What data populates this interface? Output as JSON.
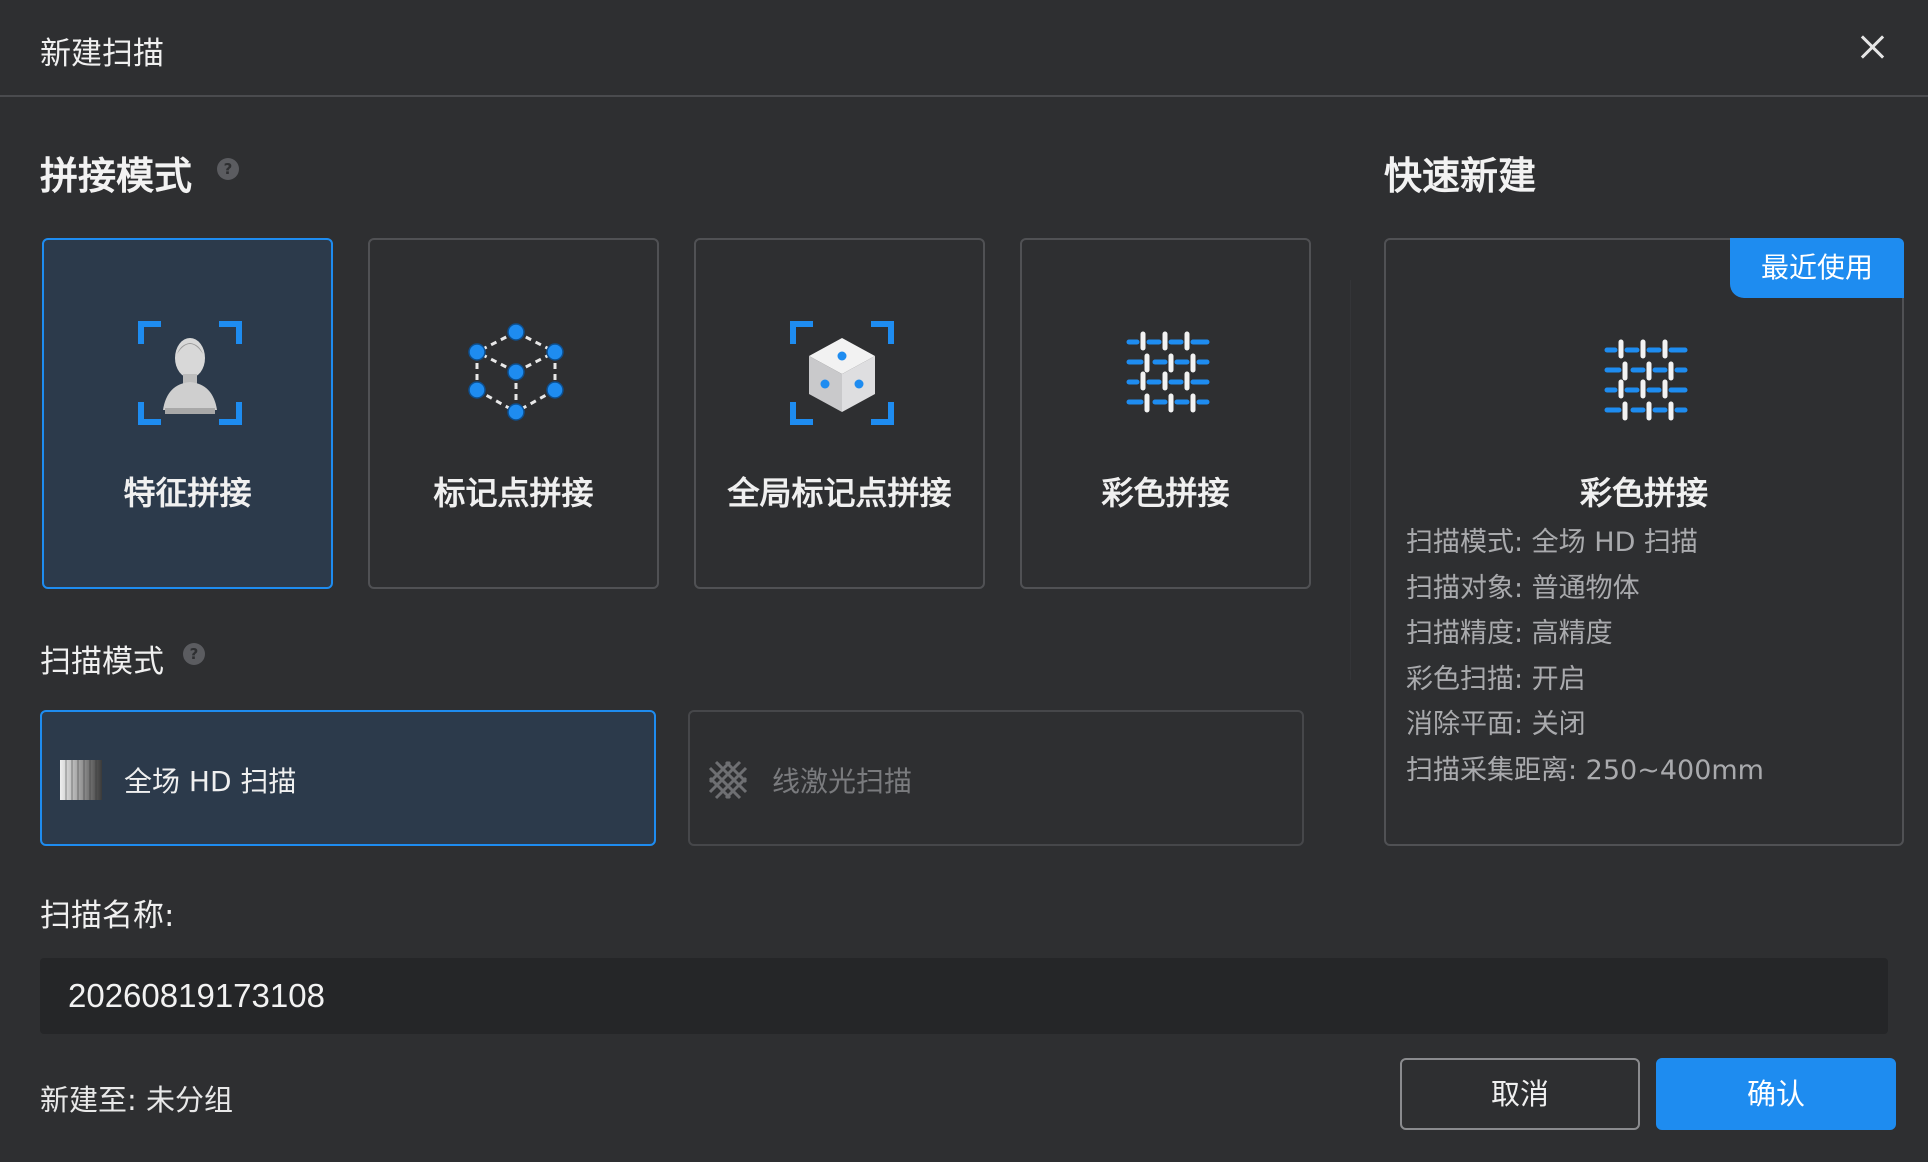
{
  "dialog": {
    "title": "新建扫描"
  },
  "stitch": {
    "heading": "拼接模式",
    "modes": [
      {
        "label": "特征拼接",
        "icon": "bust-statue-icon",
        "selected": true
      },
      {
        "label": "标记点拼接",
        "icon": "marker-points-icon",
        "selected": false
      },
      {
        "label": "全局标记点拼接",
        "icon": "global-marker-cube-icon",
        "selected": false
      },
      {
        "label": "彩色拼接",
        "icon": "color-stitch-icon",
        "selected": false
      }
    ]
  },
  "scan_mode": {
    "heading": "扫描模式",
    "options": [
      {
        "label": "全场 HD 扫描",
        "icon": "fullfield-hd-icon",
        "selected": true,
        "disabled": false
      },
      {
        "label": "线激光扫描",
        "icon": "line-laser-icon",
        "selected": false,
        "disabled": true
      }
    ]
  },
  "quick": {
    "heading": "快速新建",
    "badge": "最近使用",
    "name": "彩色拼接",
    "icon": "color-stitch-icon",
    "info": [
      "扫描模式: 全场 HD 扫描",
      "扫描对象: 普通物体",
      "扫描精度: 高精度",
      "彩色扫描: 开启",
      "消除平面: 关闭",
      "扫描采集距离: 250~400mm"
    ]
  },
  "scan_name": {
    "label": "扫描名称:",
    "value": "20260819173108"
  },
  "footer": {
    "location": "新建至: 未分组",
    "cancel": "取消",
    "confirm": "确认"
  },
  "colors": {
    "accent": "#1e8cf0",
    "background": "#2e2f31",
    "selected_bg": "#2c3a4b"
  }
}
